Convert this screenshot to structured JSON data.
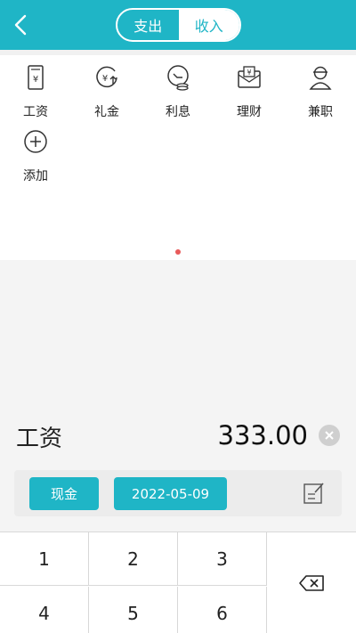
{
  "header": {
    "tabs": [
      {
        "label": "支出",
        "active": false
      },
      {
        "label": "收入",
        "active": true
      }
    ],
    "accent_color": "#1fb5c6"
  },
  "categories": [
    {
      "label": "工资",
      "icon": "salary-icon"
    },
    {
      "label": "礼金",
      "icon": "gift-money-icon"
    },
    {
      "label": "利息",
      "icon": "interest-icon"
    },
    {
      "label": "理财",
      "icon": "investment-icon"
    },
    {
      "label": "兼职",
      "icon": "part-time-icon"
    },
    {
      "label": "添加",
      "icon": "add-icon"
    }
  ],
  "entry": {
    "category": "工资",
    "amount": "333.00"
  },
  "options": {
    "account": "现金",
    "date": "2022-05-09"
  },
  "keypad": {
    "keys": [
      "1",
      "2",
      "3",
      "4",
      "5",
      "6"
    ]
  }
}
